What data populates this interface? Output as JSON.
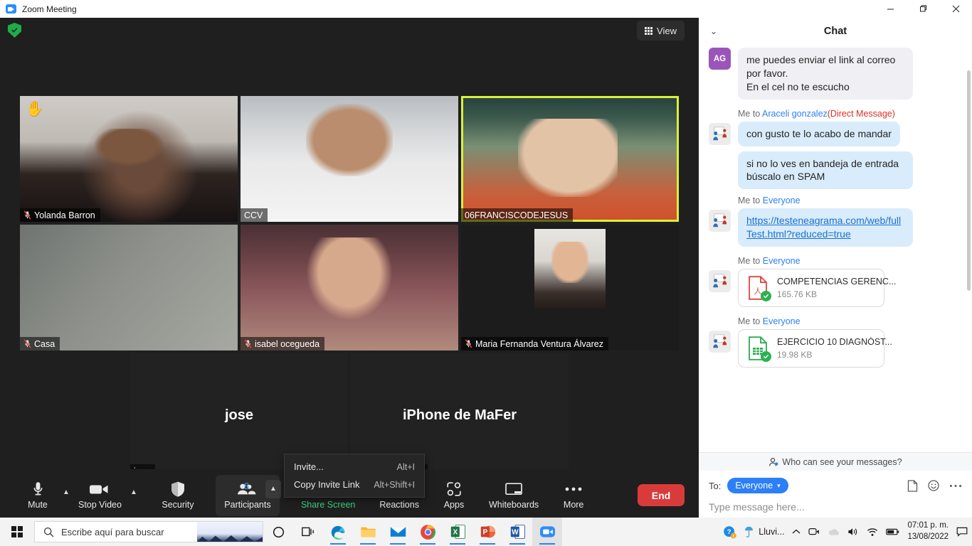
{
  "window": {
    "title": "Zoom Meeting",
    "minimize": "—",
    "maximize": "❐",
    "close": "✕"
  },
  "meeting": {
    "view_label": "View",
    "encryption_icon": "shield-check-icon",
    "participants": [
      {
        "name": "Yolanda Barron",
        "muted": true,
        "hand_raised": true,
        "active": false,
        "type": "video"
      },
      {
        "name": "CCV",
        "muted": false,
        "hand_raised": false,
        "active": false,
        "type": "video"
      },
      {
        "name": "06FRANCISCODEJESUS",
        "muted": false,
        "hand_raised": false,
        "active": true,
        "type": "video"
      },
      {
        "name": "Casa",
        "muted": true,
        "hand_raised": false,
        "active": false,
        "type": "video"
      },
      {
        "name": "isabel ocegueda",
        "muted": true,
        "hand_raised": false,
        "active": false,
        "type": "video"
      },
      {
        "name": "Maria Fernanda Ventura Álvarez",
        "muted": true,
        "hand_raised": false,
        "active": false,
        "type": "video"
      },
      {
        "name": "jose",
        "display": "jose",
        "muted": false,
        "active": false,
        "type": "name"
      },
      {
        "name": "iPhone de MaFer",
        "display": "iPhone de MaFer",
        "muted": false,
        "active": false,
        "type": "name"
      }
    ]
  },
  "invite_menu": {
    "items": [
      {
        "label": "Invite...",
        "shortcut": "Alt+I"
      },
      {
        "label": "Copy Invite Link",
        "shortcut": "Alt+Shift+I"
      }
    ]
  },
  "toolbar": {
    "mute": "Mute",
    "stop_video": "Stop Video",
    "security": "Security",
    "participants": "Participants",
    "participants_count": "8",
    "share_screen": "Share Screen",
    "reactions": "Reactions",
    "apps": "Apps",
    "whiteboards": "Whiteboards",
    "more": "More",
    "end": "End",
    "accent_green": "#3ad07e",
    "end_color": "#d93b3b"
  },
  "chat": {
    "title": "Chat",
    "messages": [
      {
        "avatar_type": "initials",
        "initials": "AG",
        "avatar_color": "#9b55b8",
        "meta": null,
        "bubbles": [
          {
            "kind": "text",
            "text": "me puedes enviar el link al correo por favor.\nEn el cel no te escucho",
            "style": "grey"
          }
        ]
      },
      {
        "avatar_type": "image",
        "meta_prefix": "Me to ",
        "meta_who": "Araceli gonzalez",
        "meta_suffix": "(Direct Message)",
        "bubbles": [
          {
            "kind": "text",
            "text": "con gusto te lo acabo de mandar",
            "style": "blue"
          },
          {
            "kind": "text",
            "text": "si no lo ves en bandeja de entrada búscalo en SPAM",
            "style": "blue"
          }
        ]
      },
      {
        "avatar_type": "image",
        "meta_prefix": "Me to ",
        "meta_who": "Everyone",
        "meta_suffix": "",
        "bubbles": [
          {
            "kind": "link",
            "text": "https://testeneagrama.com/web/fullTest.html?reduced=true",
            "style": "blue"
          }
        ]
      },
      {
        "avatar_type": "image",
        "meta_prefix": "Me to ",
        "meta_who": "Everyone",
        "meta_suffix": "",
        "bubbles": [
          {
            "kind": "file",
            "filename": "COMPETENCIAS GERENC...",
            "filesize": "165.76 KB",
            "filetype": "pdf"
          }
        ]
      },
      {
        "avatar_type": "image",
        "meta_prefix": "Me to ",
        "meta_who": "Everyone",
        "meta_suffix": "",
        "bubbles": [
          {
            "kind": "file",
            "filename": "EJERCICIO 10 DIAGNÓST...",
            "filesize": "19.98 KB",
            "filetype": "xls"
          }
        ]
      }
    ],
    "who_can_see": "Who can see your messages?",
    "to_label": "To:",
    "to_value": "Everyone",
    "input_placeholder": "Type message here..."
  },
  "taskbar": {
    "search_placeholder": "Escribe aquí para buscar",
    "weather": "Lluvi...",
    "time": "07:01 p. m.",
    "date": "13/08/2022",
    "apps": [
      "cortana-icon",
      "task-view-icon",
      "edge-icon",
      "file-explorer-icon",
      "mail-icon",
      "chrome-icon",
      "excel-icon",
      "powerpoint-icon",
      "word-icon",
      "zoom-icon"
    ]
  }
}
